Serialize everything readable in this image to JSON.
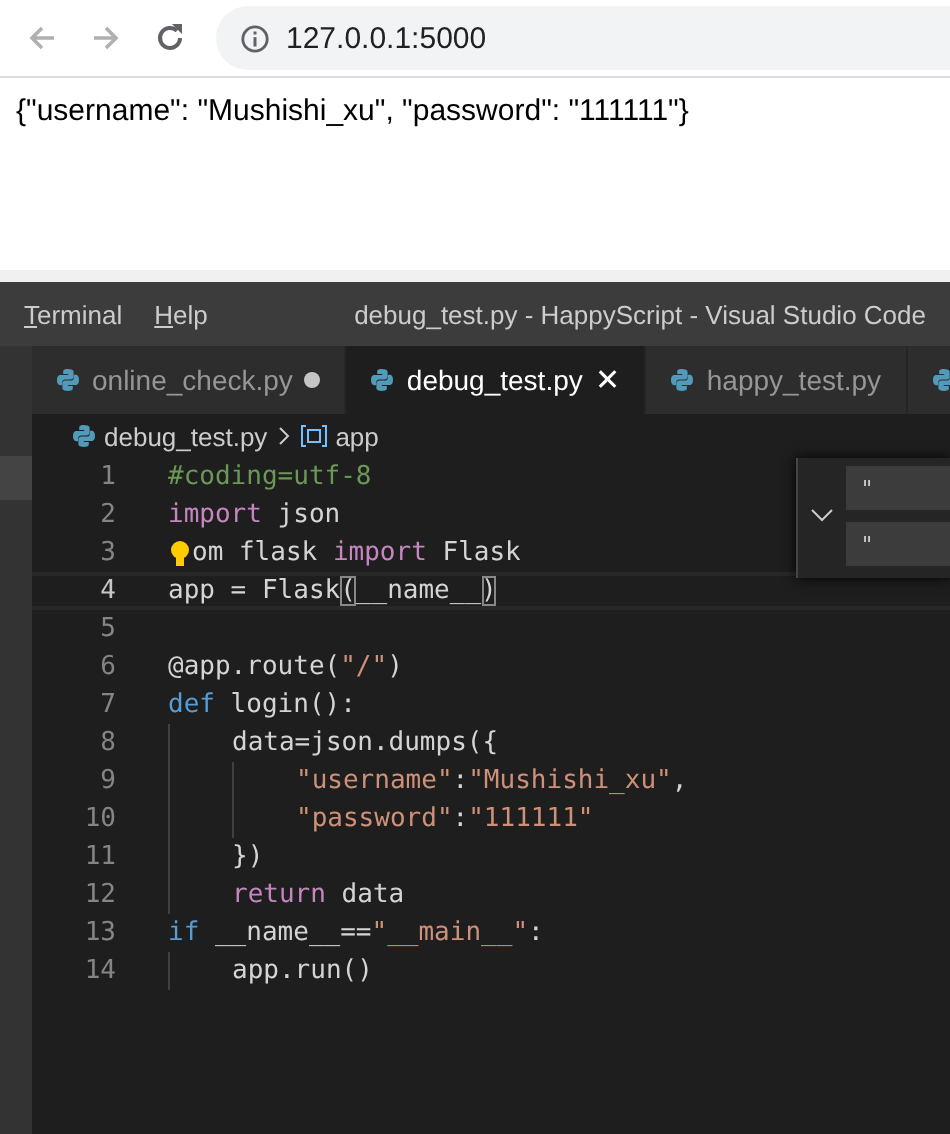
{
  "browser": {
    "url": "127.0.0.1:5000",
    "back_disabled": true,
    "forward_disabled": true,
    "body": "{\"username\": \"Mushishi_xu\", \"password\": \"111111\"}"
  },
  "vscode": {
    "menu": [
      "Terminal",
      "Help"
    ],
    "title": "debug_test.py - HappyScript - Visual Studio Code",
    "tabs": [
      {
        "label": "online_check.py",
        "selected": false,
        "modified": true
      },
      {
        "label": "debug_test.py",
        "selected": true,
        "modified": false,
        "close": "✕"
      },
      {
        "label": "happy_test.py",
        "selected": false,
        "modified": false
      },
      {
        "selected": false,
        "modified": false
      }
    ],
    "breadcrumb": {
      "file": "debug_test.py",
      "symbol": "app"
    },
    "lines": [
      {
        "number": "1",
        "current": false,
        "tokens": [
          {
            "kind": "comment",
            "text": "#coding=utf-8"
          }
        ]
      },
      {
        "number": "2",
        "current": false,
        "tokens": [
          {
            "kind": "keyword",
            "text": "import"
          },
          {
            "kind": "plain",
            "text": " json"
          }
        ]
      },
      {
        "number": "3",
        "current": false,
        "lightbulb": true,
        "tokens": [
          {
            "kind": "plain",
            "text": "om flask "
          },
          {
            "kind": "keyword",
            "text": "import"
          },
          {
            "kind": "plain",
            "text": " Flask"
          }
        ]
      },
      {
        "number": "4",
        "current": true,
        "tokens": [
          {
            "kind": "plain",
            "text": "app = Flask"
          },
          {
            "kind": "bracket",
            "text": "("
          },
          {
            "kind": "plain",
            "text": "__name__"
          },
          {
            "kind": "bracket",
            "text": ")"
          }
        ]
      },
      {
        "number": "5",
        "current": false
      },
      {
        "number": "6",
        "current": false,
        "tokens": [
          {
            "kind": "plain",
            "text": "@app.route("
          },
          {
            "kind": "string",
            "text": "\"/\""
          },
          {
            "kind": "plain",
            "text": ")"
          }
        ]
      },
      {
        "number": "7",
        "current": false,
        "tokens": [
          {
            "kind": "def",
            "text": "def"
          },
          {
            "kind": "plain",
            "text": " login():"
          }
        ],
        "children": [
          {
            "number": "8",
            "current": false,
            "tokens": [
              {
                "kind": "plain",
                "text": "data=json.dumps({"
              }
            ],
            "children": [
              {
                "number": "9",
                "current": false,
                "tokens": [
                  {
                    "kind": "string",
                    "text": "\"username\""
                  },
                  {
                    "kind": "plain",
                    "text": ":"
                  },
                  {
                    "kind": "string",
                    "text": "\"Mushishi_xu\""
                  },
                  {
                    "kind": "plain",
                    "text": ","
                  }
                ]
              },
              {
                "number": "10",
                "current": false,
                "tokens": [
                  {
                    "kind": "string",
                    "text": "\"password\""
                  },
                  {
                    "kind": "plain",
                    "text": ":"
                  },
                  {
                    "kind": "string",
                    "text": "\"111111\""
                  }
                ]
              }
            ]
          },
          {
            "number": "11",
            "current": false,
            "tokens": [
              {
                "kind": "plain",
                "text": "})"
              }
            ]
          },
          {
            "number": "12",
            "current": false,
            "tokens": [
              {
                "kind": "keyword",
                "text": "return"
              },
              {
                "kind": "plain",
                "text": " data"
              }
            ]
          }
        ]
      },
      {
        "number": "13",
        "current": false,
        "tokens": [
          {
            "kind": "def",
            "text": "if"
          },
          {
            "kind": "plain",
            "text": " __name__=="
          },
          {
            "kind": "string",
            "text": "\"__main__\""
          },
          {
            "kind": "plain",
            "text": ":"
          }
        ],
        "children": [
          {
            "number": "14",
            "current": false,
            "tokens": [
              {
                "kind": "plain",
                "text": "app.run()"
              }
            ]
          }
        ]
      }
    ],
    "suggest": {
      "items": [
        "\"",
        "\""
      ]
    }
  }
}
